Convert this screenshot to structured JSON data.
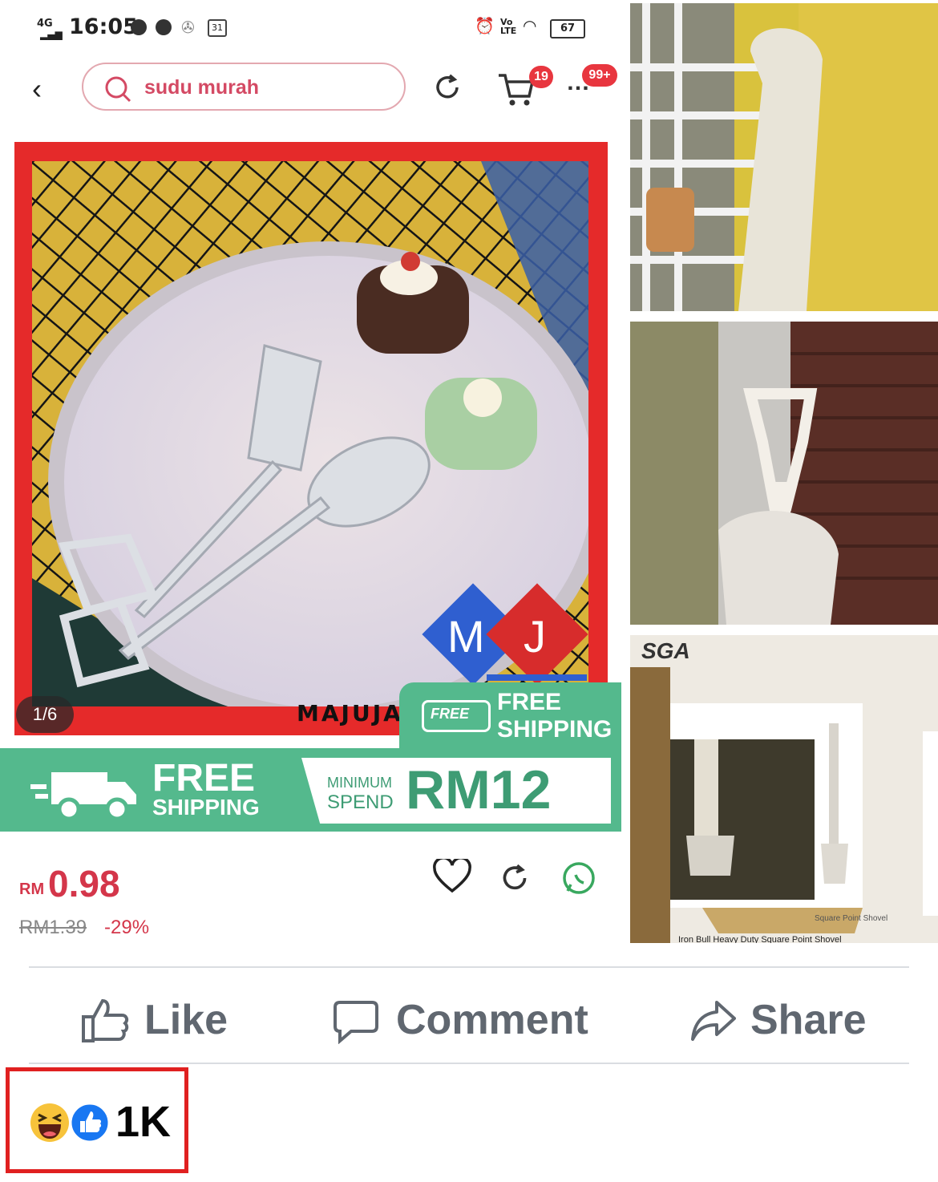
{
  "phone": {
    "status": {
      "network": "4G",
      "time": "16:05",
      "calendar": "31",
      "battery": "67"
    },
    "search": {
      "query": "sudu murah"
    },
    "cart_badge": "19",
    "more_badge": "99+",
    "image_counter": "1/6",
    "brand_watermark": "MAJUJA",
    "logo_letters": [
      "M",
      "J"
    ],
    "free_tag": {
      "small": "FREE",
      "line1": "FREE",
      "line2": "SHIPPING"
    },
    "free_banner": {
      "line1": "FREE",
      "line2": "SHIPPING",
      "min1": "MINIMUM",
      "min2": "SPEND",
      "amount": "RM12"
    },
    "price": {
      "currency": "RM",
      "value": "0.98",
      "original": "RM1.39",
      "discount": "-29%"
    }
  },
  "right_panel": {
    "thumb3": {
      "brand": "SGA",
      "caption": "Square Point Shovel",
      "product": "Iron Bull Heavy Duty Square Point Shovel"
    }
  },
  "facebook": {
    "actions": {
      "like": "Like",
      "comment": "Comment",
      "share": "Share"
    },
    "reactions": {
      "count": "1K"
    }
  },
  "colors": {
    "accent_red": "#e52a2a",
    "shipping_green": "#54b98d",
    "fb_grey": "#606770",
    "fb_blue": "#1877f2"
  }
}
